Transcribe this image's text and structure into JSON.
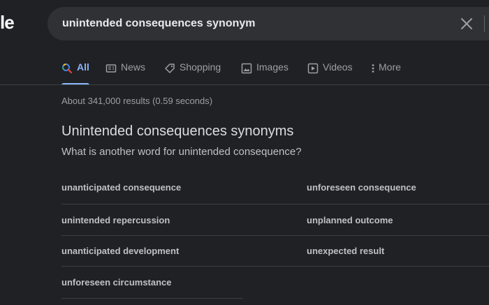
{
  "logo_fragment": "le",
  "search": {
    "query": "unintended consequences synonym"
  },
  "tabs": [
    {
      "label": "All",
      "icon": "search-icon",
      "active": true
    },
    {
      "label": "News",
      "icon": "news-icon"
    },
    {
      "label": "Shopping",
      "icon": "tag-icon"
    },
    {
      "label": "Images",
      "icon": "image-icon"
    },
    {
      "label": "Videos",
      "icon": "video-icon"
    },
    {
      "label": "More",
      "icon": "more-vertical-icon"
    }
  ],
  "result_stats": "About 341,000 results (0.59 seconds)",
  "synonyms": {
    "title": "Unintended consequences synonyms",
    "question": "What is another word for unintended consequence?",
    "rows": [
      [
        "unanticipated consequence",
        "unforeseen consequence"
      ],
      [
        "unintended repercussion",
        "unplanned outcome"
      ],
      [
        "unanticipated development",
        "unexpected result"
      ],
      [
        "unforeseen circumstance",
        ""
      ]
    ]
  },
  "colors": {
    "accent": "#8ab4f8",
    "background": "#202124",
    "surface": "#303134"
  }
}
